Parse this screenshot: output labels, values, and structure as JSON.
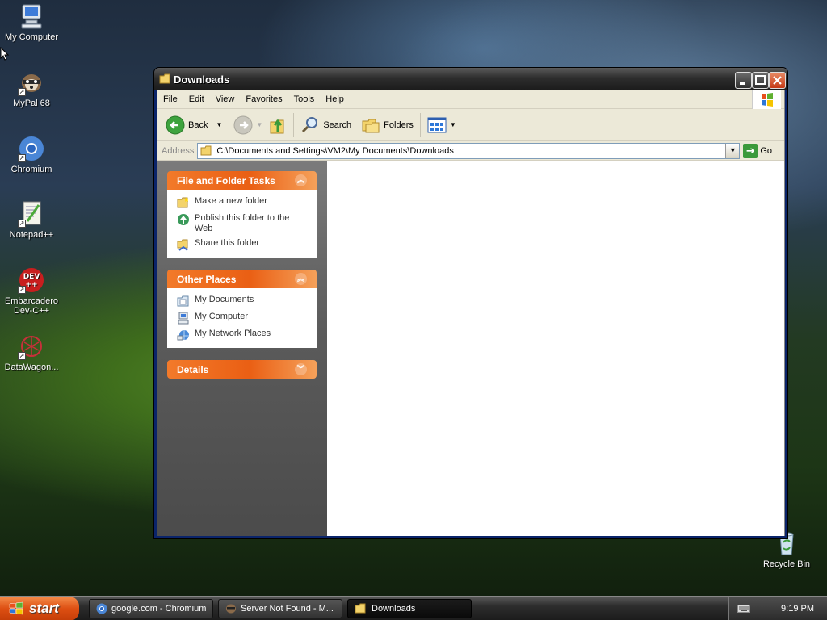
{
  "desktop": {
    "icons": [
      {
        "label": "My Computer"
      },
      {
        "label": "MyPal 68"
      },
      {
        "label": "Chromium"
      },
      {
        "label": "Notepad++"
      },
      {
        "label": "Embarcadero Dev-C++"
      },
      {
        "label": "DataWagon..."
      },
      {
        "label": "Recycle Bin"
      }
    ]
  },
  "window": {
    "title": "Downloads",
    "menu": [
      "File",
      "Edit",
      "View",
      "Favorites",
      "Tools",
      "Help"
    ],
    "toolbar": {
      "back": "Back",
      "search": "Search",
      "folders": "Folders"
    },
    "address": {
      "label": "Address",
      "value": "C:\\Documents and Settings\\VM2\\My Documents\\Downloads",
      "go": "Go"
    },
    "tasks": {
      "file_folder": {
        "title": "File and Folder Tasks",
        "items": [
          "Make a new folder",
          "Publish this folder to the Web",
          "Share this folder"
        ]
      },
      "other_places": {
        "title": "Other Places",
        "items": [
          "My Documents",
          "My Computer",
          "My Network Places"
        ]
      },
      "details": {
        "title": "Details"
      }
    }
  },
  "taskbar": {
    "start": "start",
    "items": [
      "google.com - Chromium",
      "Server Not Found - M...",
      "Downloads"
    ],
    "clock": "9:19 PM"
  }
}
